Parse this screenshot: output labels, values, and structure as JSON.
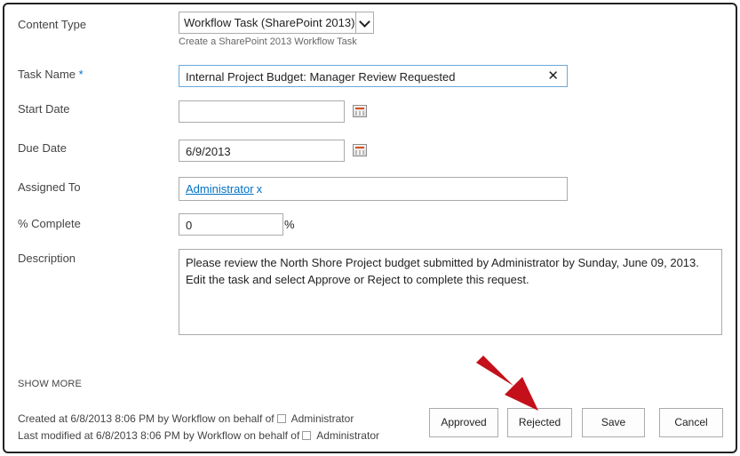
{
  "form": {
    "content_type": {
      "label": "Content Type",
      "value": "Workflow Task (SharePoint 2013)",
      "hint": "Create a SharePoint 2013 Workflow Task"
    },
    "task_name": {
      "label": "Task Name",
      "required_marker": "*",
      "value": "Internal Project Budget: Manager Review Requested",
      "clear_glyph": "✕"
    },
    "start_date": {
      "label": "Start Date",
      "value": ""
    },
    "due_date": {
      "label": "Due Date",
      "value": "6/9/2013"
    },
    "assigned_to": {
      "label": "Assigned To",
      "person": "Administrator",
      "remove_glyph": "x"
    },
    "percent_complete": {
      "label": "% Complete",
      "value": "0",
      "unit": "%"
    },
    "description": {
      "label": "Description",
      "value": "Please review the North Shore Project budget submitted by Administrator by Sunday, June 09, 2013. Edit the task and select Approve or Reject to complete this request."
    }
  },
  "show_more": "SHOW MORE",
  "footer": {
    "created_prefix": "Created at 6/8/2013 8:06 PM  by Workflow on behalf of",
    "created_by": "Administrator",
    "modified_prefix": "Last modified at 6/8/2013 8:06 PM  by Workflow on behalf of",
    "modified_by": "Administrator"
  },
  "buttons": {
    "approved": "Approved",
    "rejected": "Rejected",
    "save": "Save",
    "cancel": "Cancel"
  },
  "colors": {
    "accent": "#0072c6",
    "annotation_arrow": "#c4101a"
  }
}
